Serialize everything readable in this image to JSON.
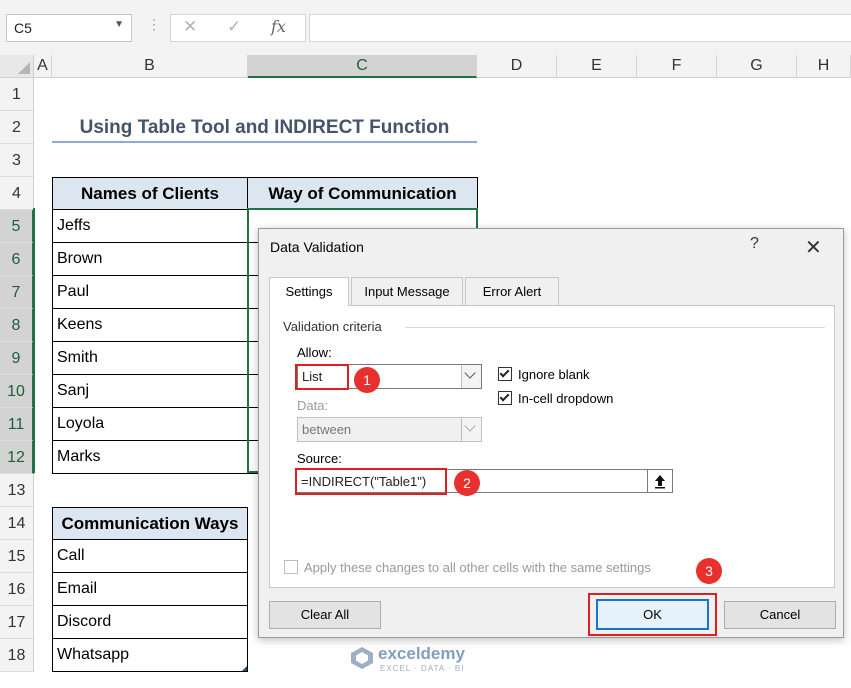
{
  "formula_bar": {
    "name_box": "C5",
    "cancel_icon": "x-icon",
    "enter_icon": "check-icon",
    "function_label": "fx",
    "formula": ""
  },
  "columns": [
    "A",
    "B",
    "C",
    "D",
    "E",
    "F",
    "G",
    "H"
  ],
  "rows": [
    "1",
    "2",
    "3",
    "4",
    "5",
    "6",
    "7",
    "8",
    "9",
    "10",
    "11",
    "12",
    "13",
    "14",
    "15",
    "16",
    "17",
    "18"
  ],
  "sheet": {
    "title": "Using Table Tool and INDIRECT Function",
    "table1": {
      "headers": [
        "Names of Clients",
        "Way of Communication"
      ],
      "clients": [
        "Jeffs",
        "Brown",
        "Paul",
        "Keens",
        "Smith",
        "Sanj",
        "Loyola",
        "Marks"
      ]
    },
    "table2": {
      "header": "Communication Ways",
      "values": [
        "Call",
        "Email",
        "Discord",
        "Whatsapp"
      ]
    }
  },
  "dialog": {
    "title": "Data Validation",
    "help": "?",
    "close": "✕",
    "tabs": [
      "Settings",
      "Input Message",
      "Error Alert"
    ],
    "active_tab": "Settings",
    "criteria_label": "Validation criteria",
    "allow_label": "Allow:",
    "allow_value": "List",
    "ignore_blank": {
      "label": "Ignore blank",
      "checked": true
    },
    "in_cell_dropdown": {
      "label": "In-cell dropdown",
      "checked": true
    },
    "data_label": "Data:",
    "data_value": "between",
    "source_label": "Source:",
    "source_value": "=INDIRECT(\"Table1\")",
    "apply_all_label": "Apply these changes to all other cells with the same settings",
    "clear_all_label": "Clear All",
    "ok_label": "OK",
    "cancel_label": "Cancel"
  },
  "annotations": [
    "1",
    "2",
    "3"
  ],
  "watermark": {
    "name": "exceldemy",
    "tagline": "EXCEL · DATA · BI"
  },
  "colors": {
    "accent_green": "#217346",
    "header_fill": "#dce6f1",
    "title_text": "#44546a",
    "highlight_red": "#e02020",
    "ok_border": "#1a73d1"
  }
}
